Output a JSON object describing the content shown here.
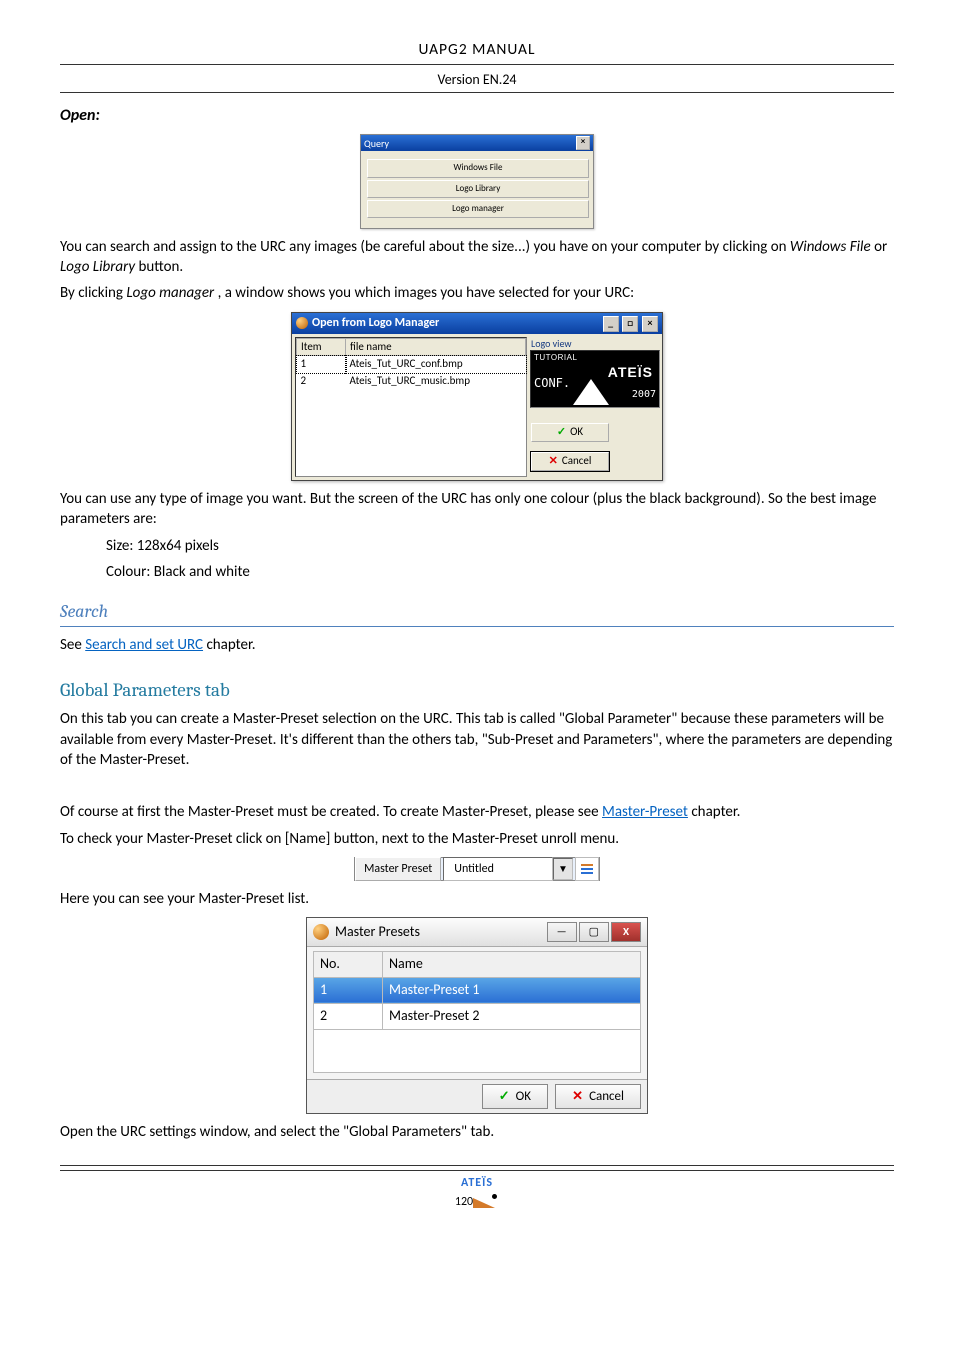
{
  "header": {
    "h1": "UAPG2  MANUAL",
    "h2": "Version EN.24"
  },
  "open": {
    "heading": "Open:",
    "query_dialog": {
      "title": "Query",
      "buttons": [
        "Windows File",
        "Logo Library",
        "Logo manager"
      ]
    },
    "p1_a": "You can search and assign to the URC any images (be careful about the size...) you have on your computer by clicking on ",
    "p1_i1": "Windows File",
    "p1_b": " or ",
    "p1_i2": "Logo Library",
    "p1_c": " button.",
    "p2_a": "By clicking ",
    "p2_i1": "Logo manager",
    "p2_b": ", a window shows you which images you have selected for your URC:",
    "lm_dialog": {
      "title": "Open from Logo Manager",
      "cols": {
        "item": "Item",
        "file": "file name"
      },
      "rows": [
        {
          "item": "1",
          "file": "Ateis_Tut_URC_conf.bmp"
        },
        {
          "item": "2",
          "file": "Ateis_Tut_URC_music.bmp"
        }
      ],
      "logo_view_label": "Logo view",
      "logo_top": "TUTORIAL",
      "logo_brand": "ATEÏS",
      "logo_conf": "CONF.",
      "logo_year": "2007",
      "ok": "OK",
      "cancel": "Cancel"
    },
    "p3": "You can use any type of image you want. But the screen of the URC has only one colour (plus the black background). So the best image parameters are:",
    "param1": "Size: 128x64 pixels",
    "param2": "Colour: Black and white"
  },
  "search": {
    "heading": "Search",
    "p_a": "See  ",
    "link": "Search and set URC",
    "p_b": " chapter."
  },
  "global": {
    "heading": "Global Parameters tab",
    "p1": "On this tab you can create a Master-Preset selection on the URC. This tab is called \"Global Parameter\" because these parameters will be available from every Master-Preset. It's different than the others tab, \"Sub-Preset and Parameters\", where the parameters are depending of the Master-Preset.",
    "p2_a": "Of course at first the Master-Preset must be created. To create Master-Preset, please see ",
    "p2_link": "Master-Preset",
    "p2_b": " chapter.",
    "p3": "To check your Master-Preset click on [Name] button, next to the Master-Preset unroll menu.",
    "mp_bar": {
      "label": "Master Preset",
      "value": "Untitled"
    },
    "p4": "Here you can see your Master-Preset list.",
    "mp_dialog": {
      "title": "Master Presets",
      "cols": {
        "no": "No.",
        "name": "Name"
      },
      "rows": [
        {
          "no": "1",
          "name": "Master-Preset 1"
        },
        {
          "no": "2",
          "name": "Master-Preset 2"
        }
      ],
      "ok": "OK",
      "cancel": "Cancel"
    },
    "p5": "Open the URC settings window, and select the \"Global Parameters\" tab."
  },
  "footer": {
    "brand": "ATEÏS",
    "page": "120"
  }
}
